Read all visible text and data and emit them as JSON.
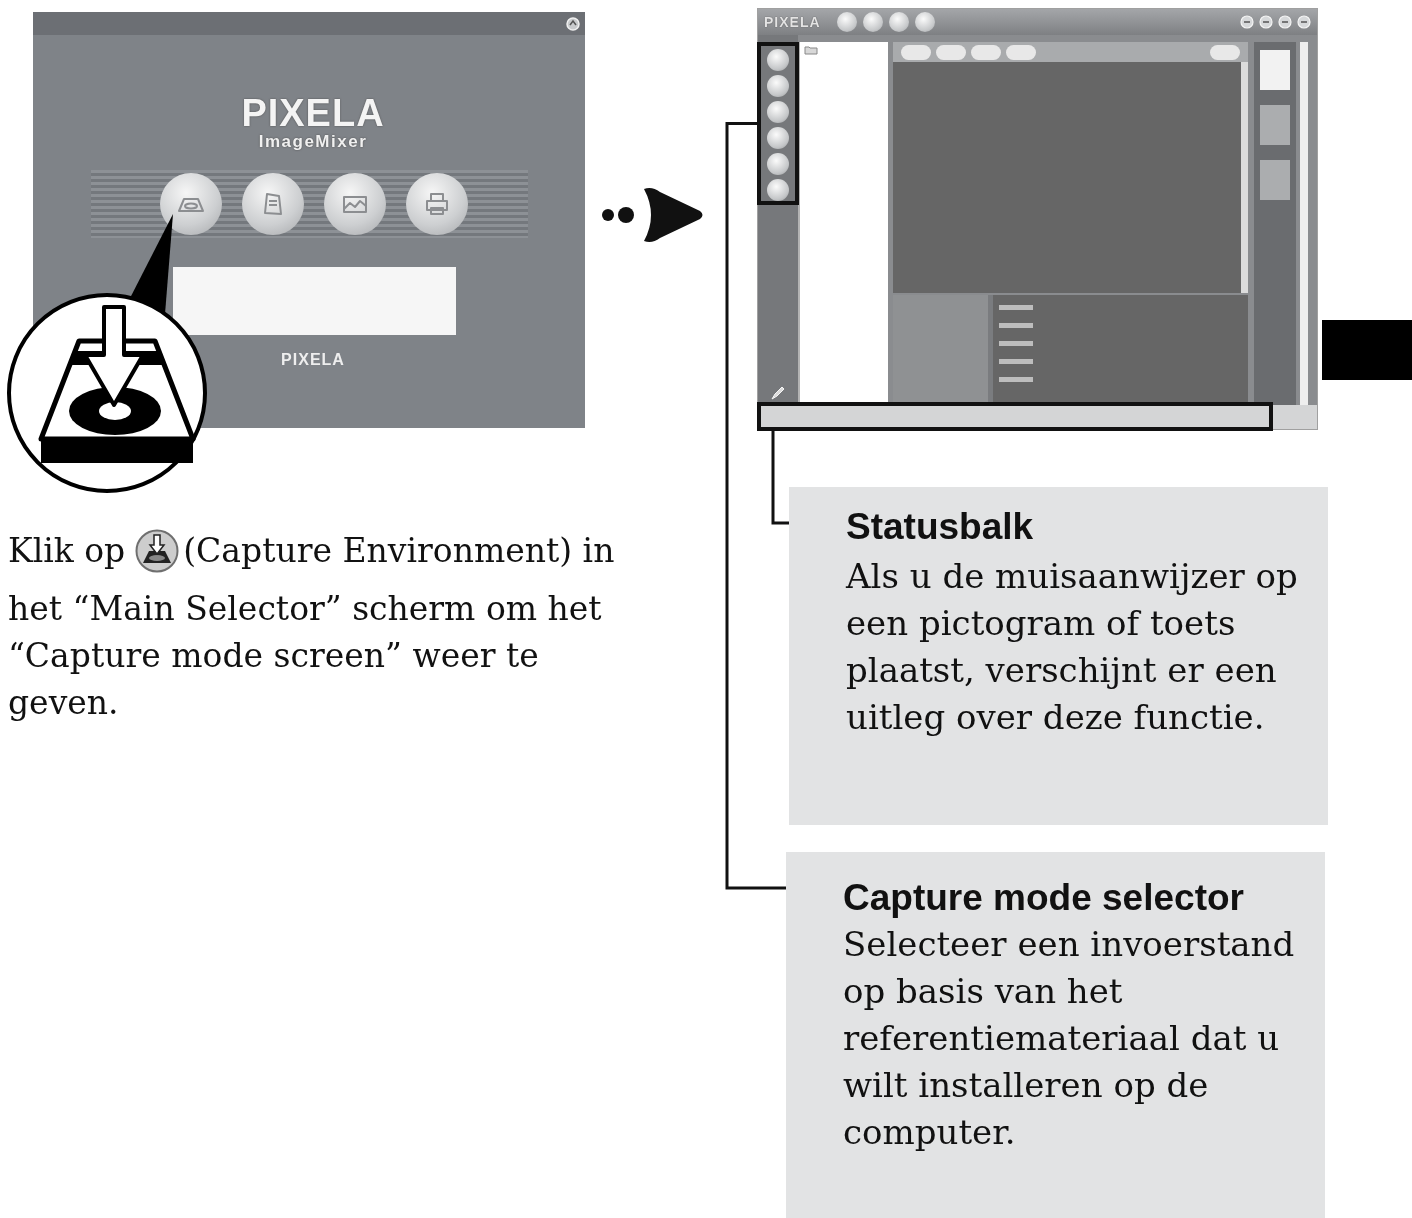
{
  "main_selector_window": {
    "logo": "PIXELA",
    "logo_subtitle": "ImageMixer",
    "buttons": [
      {
        "kind": "tray"
      },
      {
        "kind": "page"
      },
      {
        "kind": "picture"
      },
      {
        "kind": "printer"
      }
    ],
    "footer_logo": "PIXELA"
  },
  "instruction": {
    "before_icon": "Klik op",
    "after_icon": "(Capture Environment) in",
    "continuation": "het “Main Selector” scherm om het “Capture mode screen” weer te geven."
  },
  "capture_window": {
    "logo": "PIXELA"
  },
  "callouts": [
    {
      "kind": "status_bar",
      "title": "Statusbalk",
      "text": "Als u de muisaanwijzer op een pictogram of toets plaatst, verschijnt er een uitleg over deze functie."
    },
    {
      "kind": "mode_selector",
      "title": "Capture mode selector",
      "text": "Selecteer een invoerstand op basis van het referentiemateriaal dat u wilt installeren op de computer."
    }
  ]
}
